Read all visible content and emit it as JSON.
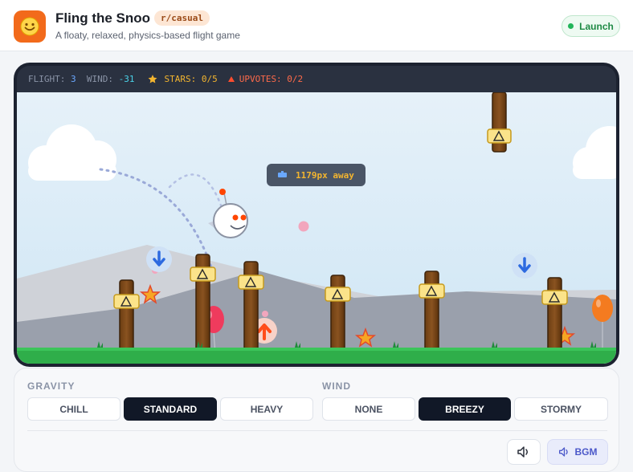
{
  "header": {
    "app_icon": "smiley-icon",
    "title": "Fling the Snoo",
    "subreddit": "r/casual",
    "subtitle": "A floaty, relaxed, physics-based flight game",
    "launch_label": "Launch",
    "launch_status_color": "#22b55a"
  },
  "hud": {
    "flight_label": "FLIGHT: ",
    "flight_value": "3",
    "wind_label": "  WIND: ",
    "wind_value": "-31",
    "stars_label": "STARS: 0/5",
    "upvotes_label": "UPVOTES: 0/2"
  },
  "game": {
    "distance_label": "1179px away",
    "distance_icon": "target-icon",
    "player_icon": "snoo-icon",
    "obstacle_icon": "warning-icon",
    "star_icon": "star-icon",
    "upvote_icon": "upvote-arrow-icon",
    "downdraft_icon": "down-arrow-icon",
    "balloon_colors": [
      "#ef3b5d",
      "#f47b20"
    ],
    "sky_color": "#d9ecf8",
    "ground_color": "#2fae4a"
  },
  "controls": {
    "gravity_label": "GRAVITY",
    "gravity_options": [
      "CHILL",
      "STANDARD",
      "HEAVY"
    ],
    "gravity_selected": "STANDARD",
    "wind_label": "WIND",
    "wind_options": [
      "NONE",
      "BREEZY",
      "STORMY"
    ],
    "wind_selected": "BREEZY",
    "sound_icon": "speaker-icon",
    "bgm_label": "BGM",
    "bgm_icon": "speaker-icon"
  }
}
